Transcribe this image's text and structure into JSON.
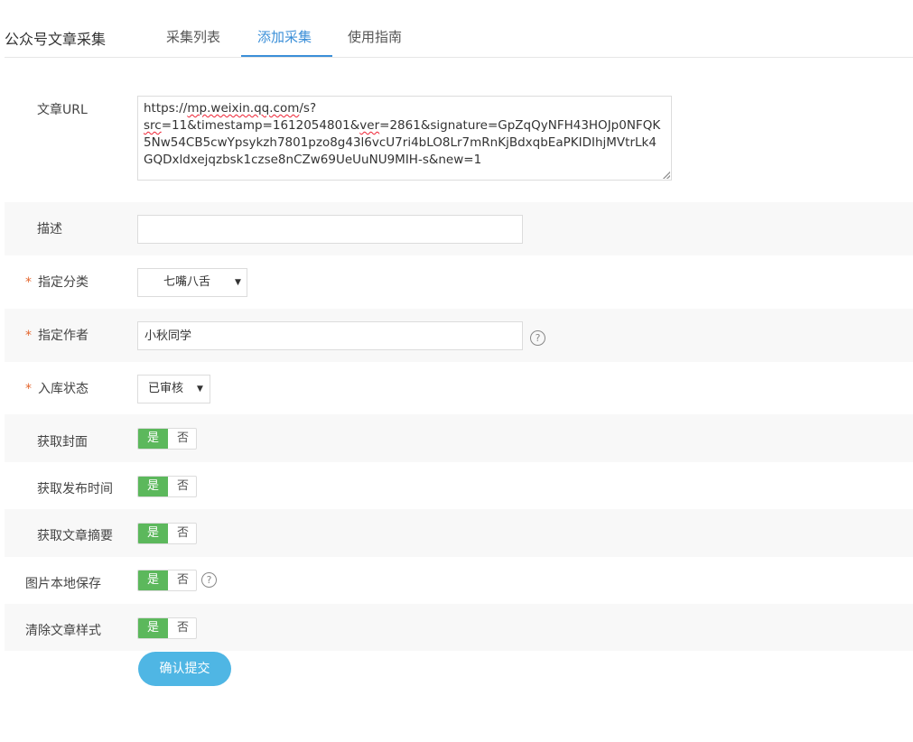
{
  "app": {
    "title": "公众号文章采集"
  },
  "tabs": [
    {
      "label": "采集列表",
      "active": false
    },
    {
      "label": "添加采集",
      "active": true
    },
    {
      "label": "使用指南",
      "active": false
    }
  ],
  "form": {
    "url": {
      "label": "文章URL",
      "value_parts": [
        "https://",
        "mp.weixin.qq.com",
        "/s?",
        "src",
        "=11&timestamp=1612054801&",
        "ver",
        "=2861&signature=GpZqQyNFH43HOJp0NFQK5Nw54CB5cwYpsykzh7801pzo8g43l6vcU7ri4bLO8Lr7mRnKjBdxqbEaPKIDIhjMVtrLk4GQDxldxejqzbsk1czse8nCZw69UeUuNU9MIH-s&new=1"
      ]
    },
    "description": {
      "label": "描述",
      "value": ""
    },
    "category": {
      "label": "指定分类",
      "required_mark": "*",
      "value": "七嘴八舌"
    },
    "author": {
      "label": "指定作者",
      "required_mark": "*",
      "value": "小秋同学"
    },
    "status": {
      "label": "入库状态",
      "required_mark": "*",
      "value": "已审核"
    },
    "toggles": [
      {
        "label": "获取封面",
        "yes": "是",
        "no": "否",
        "selected": "是"
      },
      {
        "label": "获取发布时间",
        "yes": "是",
        "no": "否",
        "selected": "是"
      },
      {
        "label": "获取文章摘要",
        "yes": "是",
        "no": "否",
        "selected": "是"
      },
      {
        "label": "图片本地保存",
        "yes": "是",
        "no": "否",
        "selected": "是"
      },
      {
        "label": "清除文章样式",
        "yes": "是",
        "no": "否",
        "selected": "是"
      }
    ],
    "submit_label": "确认提交"
  },
  "icons": {
    "help": "question-circle-icon",
    "dropdown": "caret-down-icon"
  },
  "colors": {
    "accent": "#3b8fd8",
    "toggle_on": "#5cb85c",
    "submit": "#4fb6e4",
    "required": "#e4672f"
  }
}
